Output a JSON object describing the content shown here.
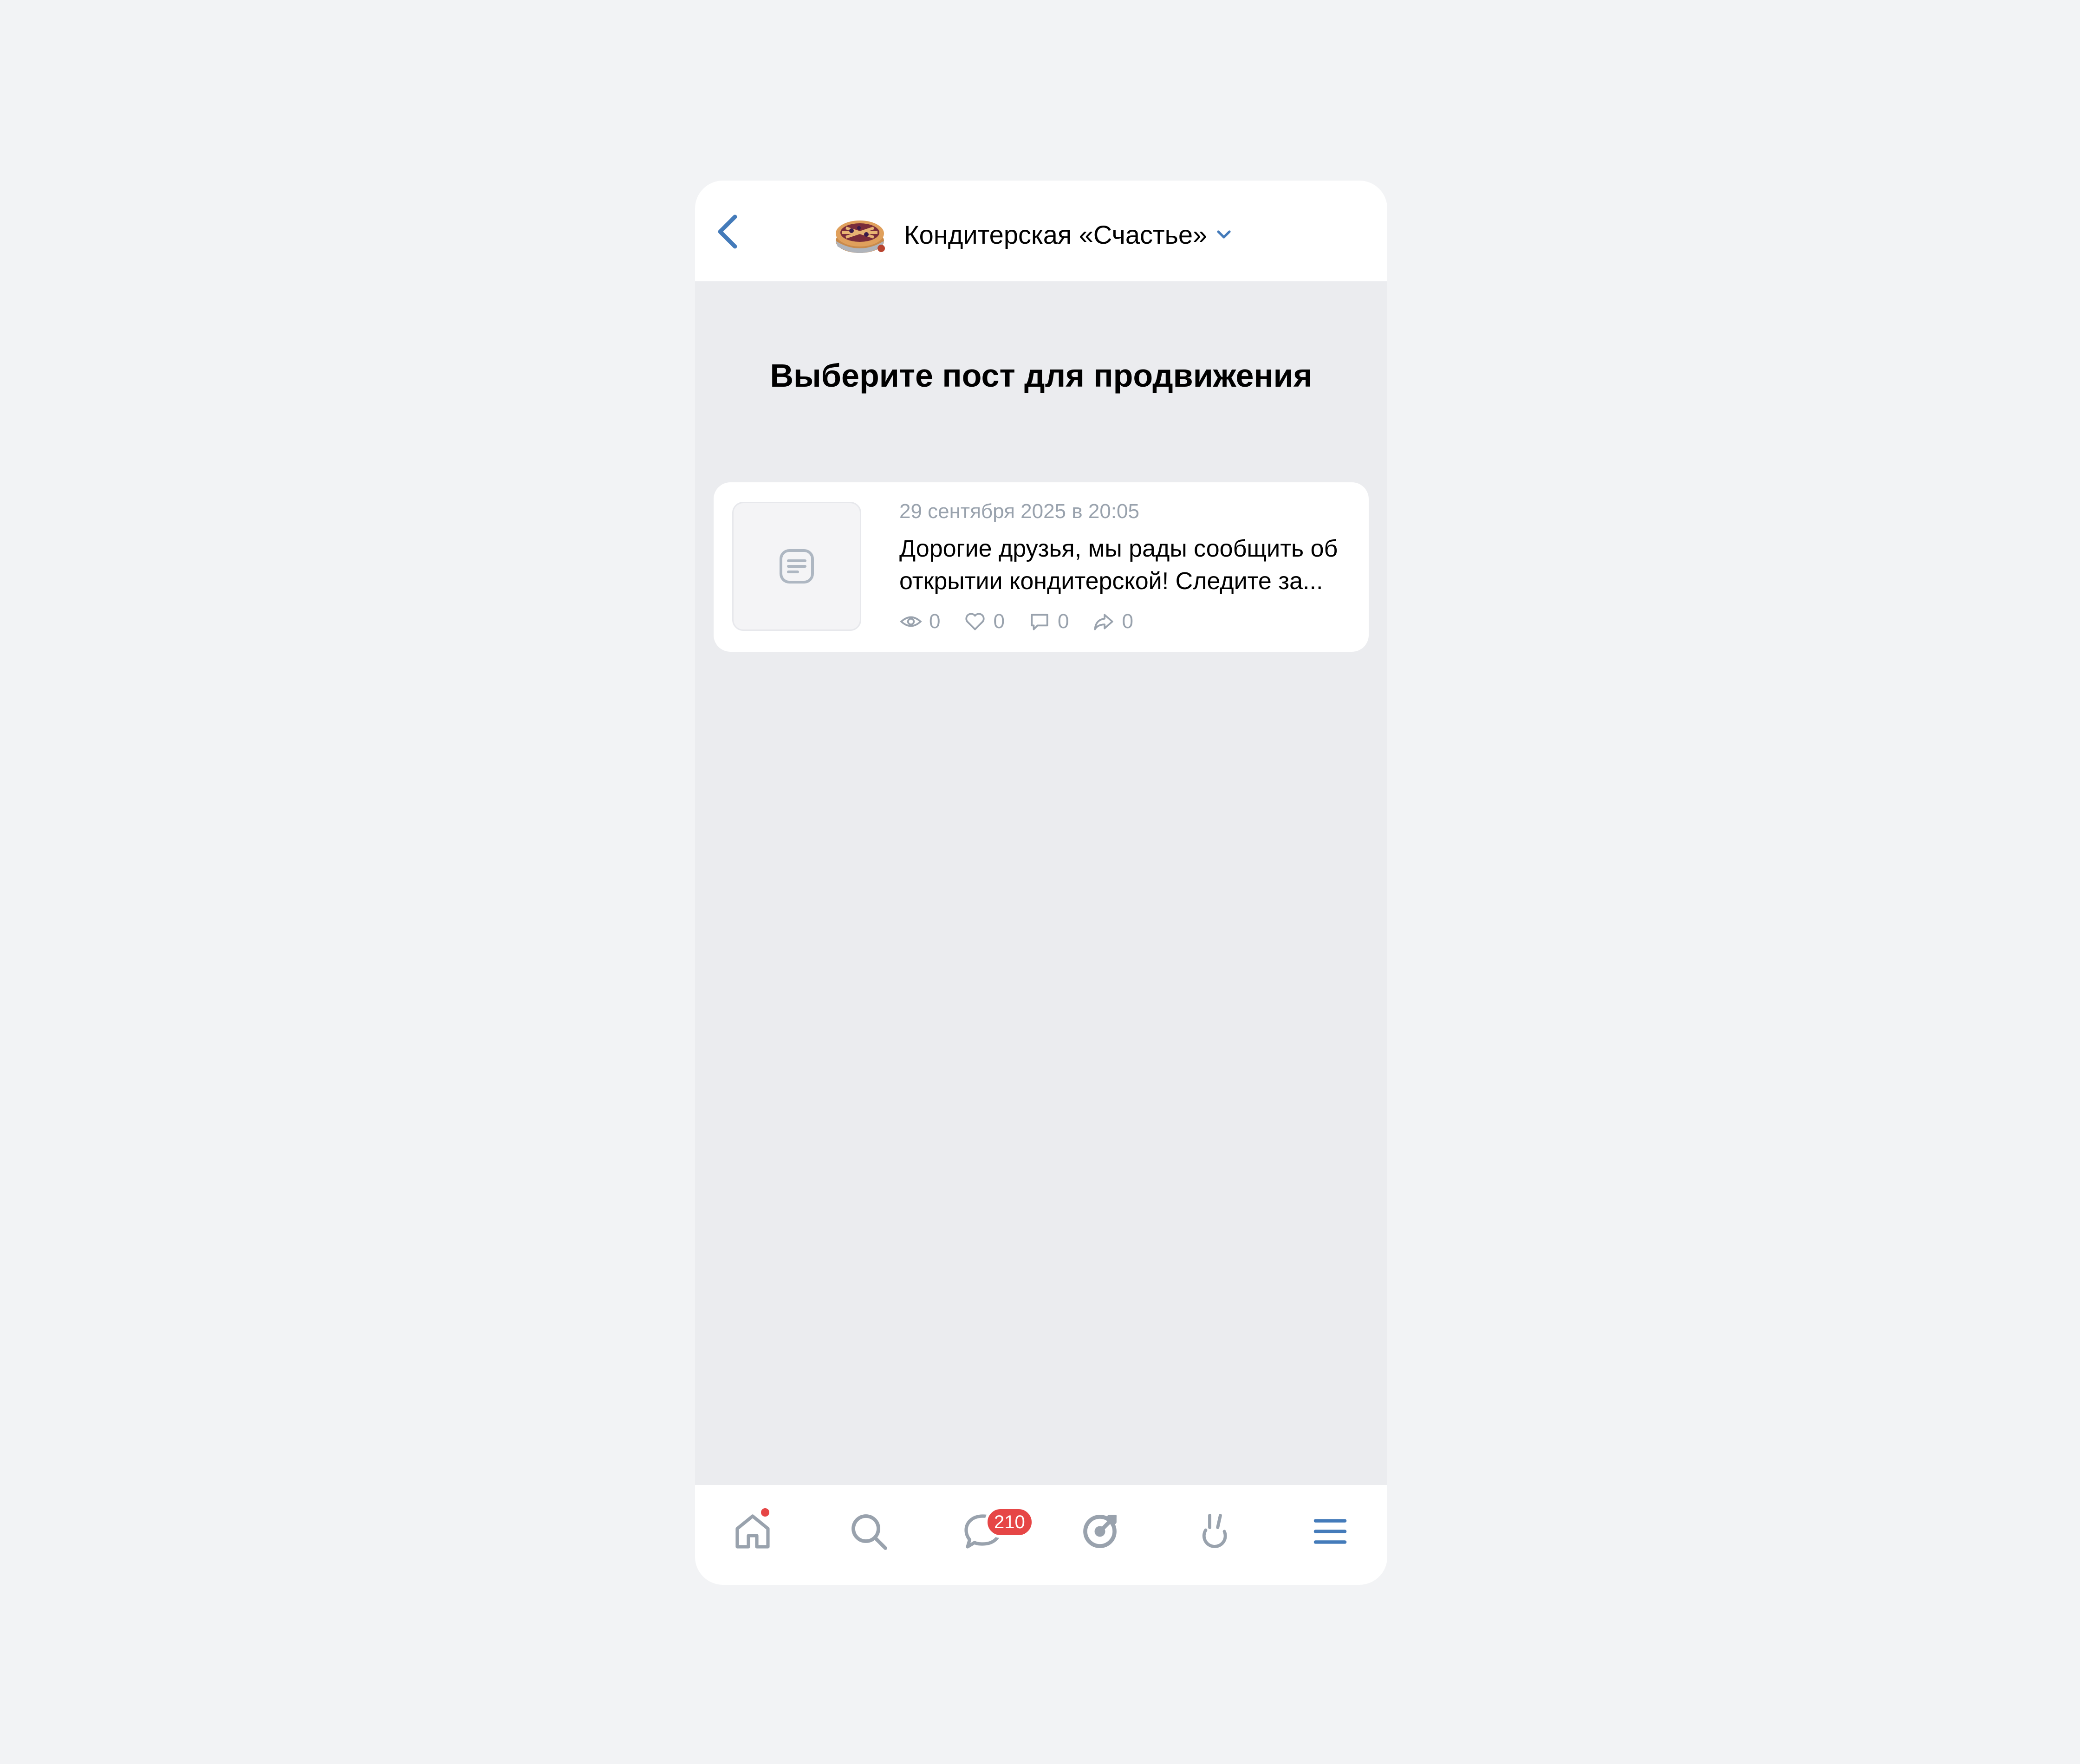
{
  "header": {
    "community_name": "Кондитерская «Счастье»"
  },
  "page": {
    "title": "Выберите пост для продвижения"
  },
  "posts": [
    {
      "date": "29 сентября 2025 в 20:05",
      "text": "Дорогие друзья, мы рады сообщить об открытии кондитерской! Следите за...",
      "views": "0",
      "likes": "0",
      "comments": "0",
      "shares": "0"
    }
  ],
  "tabbar": {
    "messages_badge": "210",
    "items": [
      "home-icon",
      "search-icon",
      "messages-icon",
      "clips-icon",
      "services-icon",
      "menu-icon"
    ]
  },
  "colors": {
    "accent": "#447bba",
    "badge": "#e64646",
    "secondary_text": "#99a2ad",
    "icon_gray": "#99a2ad",
    "background": "#ebecef"
  }
}
